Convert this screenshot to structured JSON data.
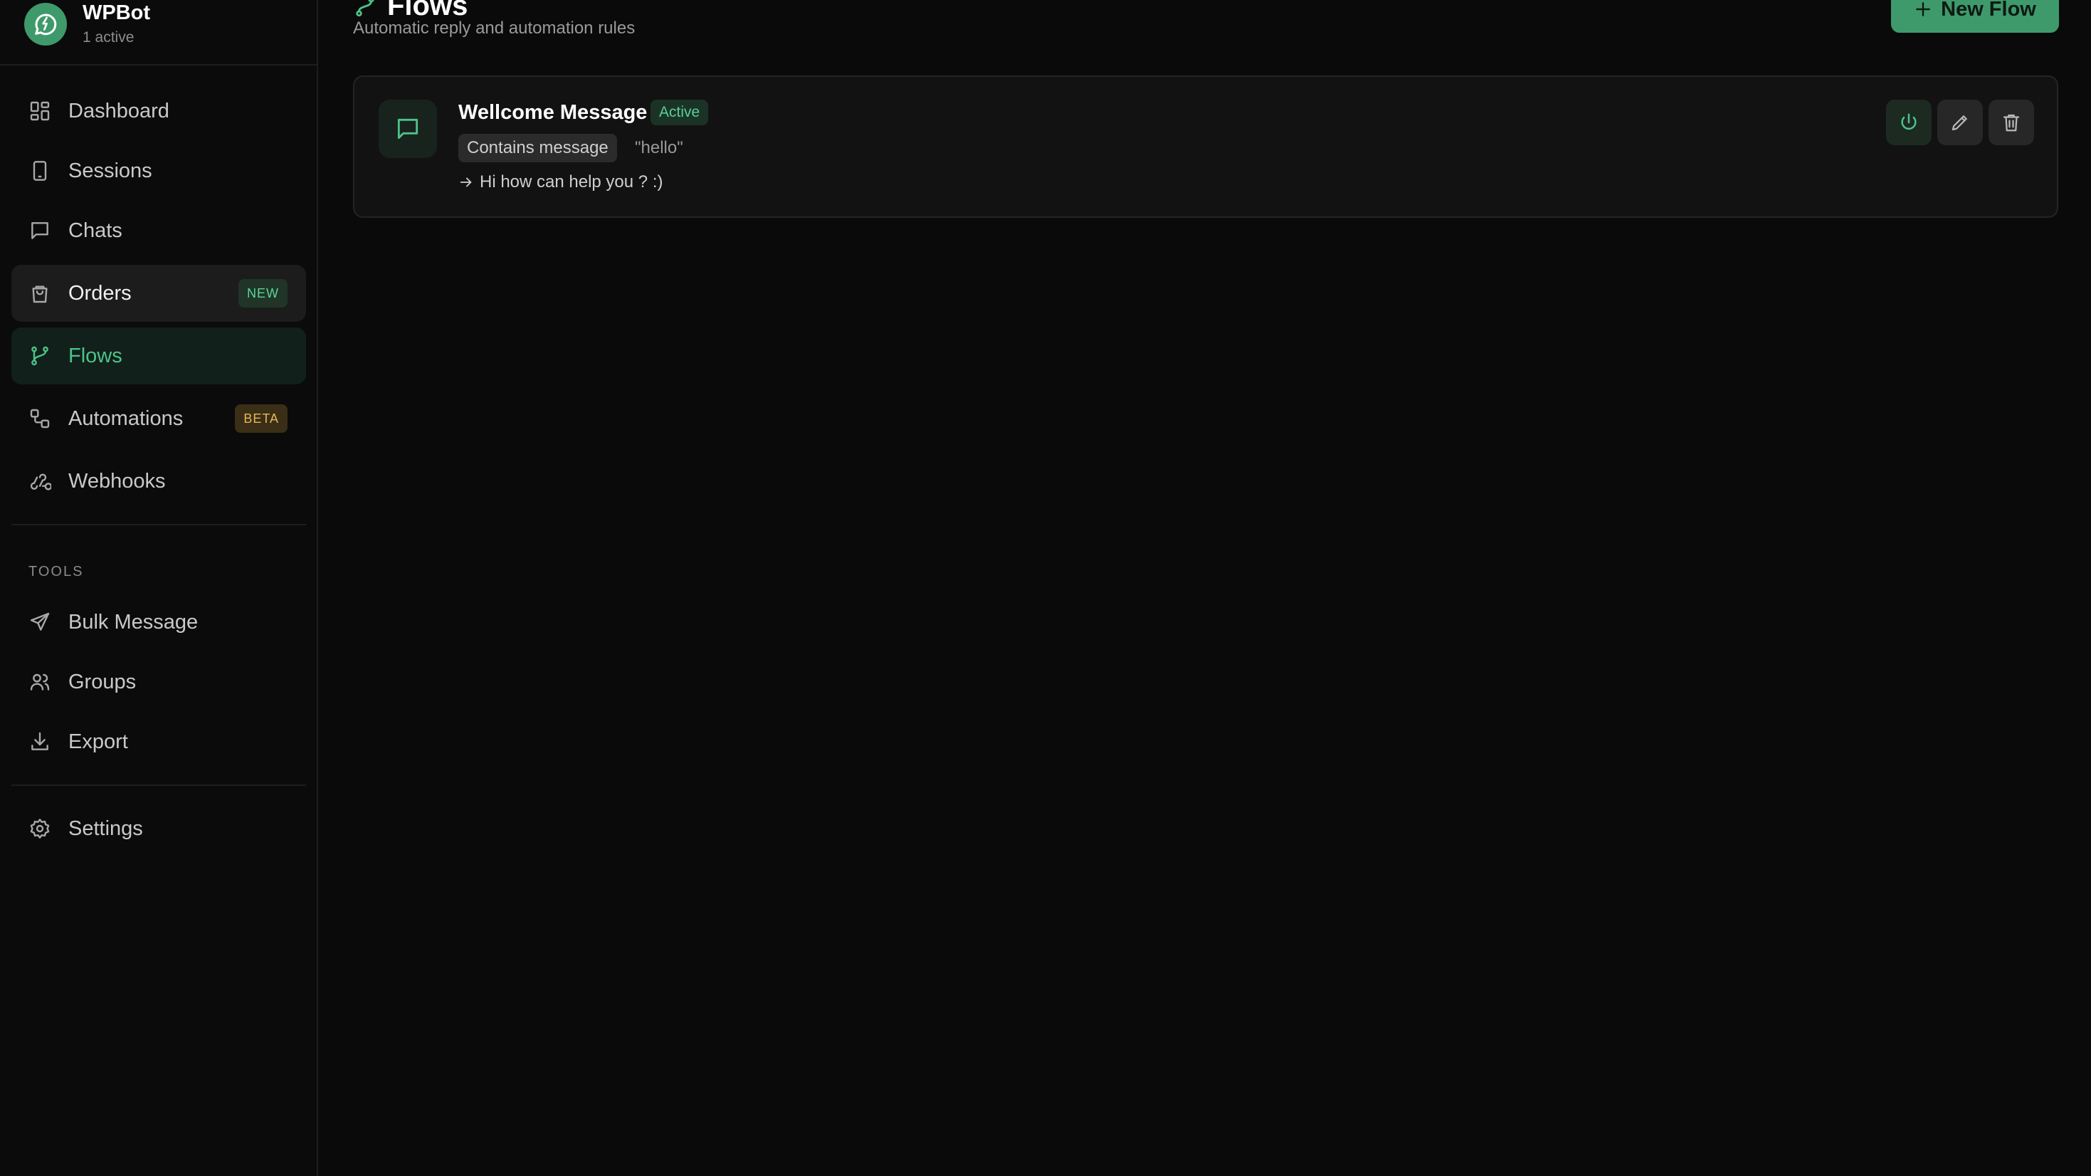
{
  "brand": {
    "name": "WPBot",
    "status": "1 active"
  },
  "sidebar": {
    "items": [
      {
        "label": "Dashboard",
        "icon": "dashboard-icon"
      },
      {
        "label": "Sessions",
        "icon": "phone-icon"
      },
      {
        "label": "Chats",
        "icon": "chat-icon"
      },
      {
        "label": "Orders",
        "icon": "shopping-bag-icon",
        "badge": "NEW"
      },
      {
        "label": "Flows",
        "icon": "git-branch-icon",
        "active": true
      },
      {
        "label": "Automations",
        "icon": "workflow-icon",
        "badge": "BETA"
      },
      {
        "label": "Webhooks",
        "icon": "webhook-icon"
      }
    ],
    "tools_title": "TOOLS",
    "tools": [
      {
        "label": "Bulk Message",
        "icon": "send-icon"
      },
      {
        "label": "Groups",
        "icon": "users-icon"
      },
      {
        "label": "Export",
        "icon": "download-icon"
      }
    ],
    "settings_label": "Settings"
  },
  "header": {
    "title": "Flows",
    "subtitle": "Automatic reply and automation rules",
    "new_flow_label": "New Flow"
  },
  "flows": [
    {
      "name": "Wellcome Message",
      "status": "Active",
      "condition_type": "Contains message",
      "condition_value": "\"hello\"",
      "reply": "Hi how can help you ? :)"
    }
  ],
  "colors": {
    "accent": "#3f9a6b",
    "accent_text": "#4cc38a",
    "background": "#0a0a0a",
    "card": "#121212",
    "beta": "#e8b656"
  }
}
